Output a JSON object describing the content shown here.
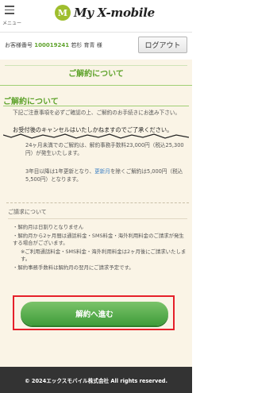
{
  "header": {
    "menu_label": "メニュー",
    "logo_mark": "M",
    "logo_text": "My X-mobile"
  },
  "customer": {
    "label": "お客様番号",
    "number": "100019241",
    "name": "若杉 育青 様",
    "logout_label": "ログアウト"
  },
  "page": {
    "title": "ご解約について"
  },
  "section": {
    "title": "ご解約について",
    "intro": "下記ご注意事項を必ずご確認の上、ご解約のお手続きにお進み下さい。",
    "notice": "お受付後のキャンセルはいたしかねますのでご了承ください。",
    "fee1": "24ヶ月未満でのご解約は、解約事務手数料23,000円（税込25,300円）が発生いたします。",
    "fee2_pre": "3年目以降は1年更新となり、",
    "fee2_highlight": "更新月",
    "fee2_post": "を除くご解約は5,000円（税込5,500円）となります。"
  },
  "billing": {
    "title": "ご請求について",
    "items": [
      "・解約月は日割りとなりません",
      "・解約月から2ヶ月間は通話料金・SMS料金・海外利用料金のご請求が発生する場合がございます。",
      "※ご利用通話料金・SMS料金・海外利用料金は2ヶ月後にご請求いたします。",
      "・解約事務手数料は解約月の翌月にご請求予定です。"
    ]
  },
  "cta": {
    "label": "解約へ進む"
  },
  "footer": {
    "copyright": "© 2024エックスモバイル株式会社 All rights reserved."
  },
  "colors": {
    "brand_green": "#5fa32c",
    "cta_green": "#3f9c3a",
    "highlight_red": "#e5202a",
    "background": "#faf4e6",
    "footer": "#333333"
  }
}
